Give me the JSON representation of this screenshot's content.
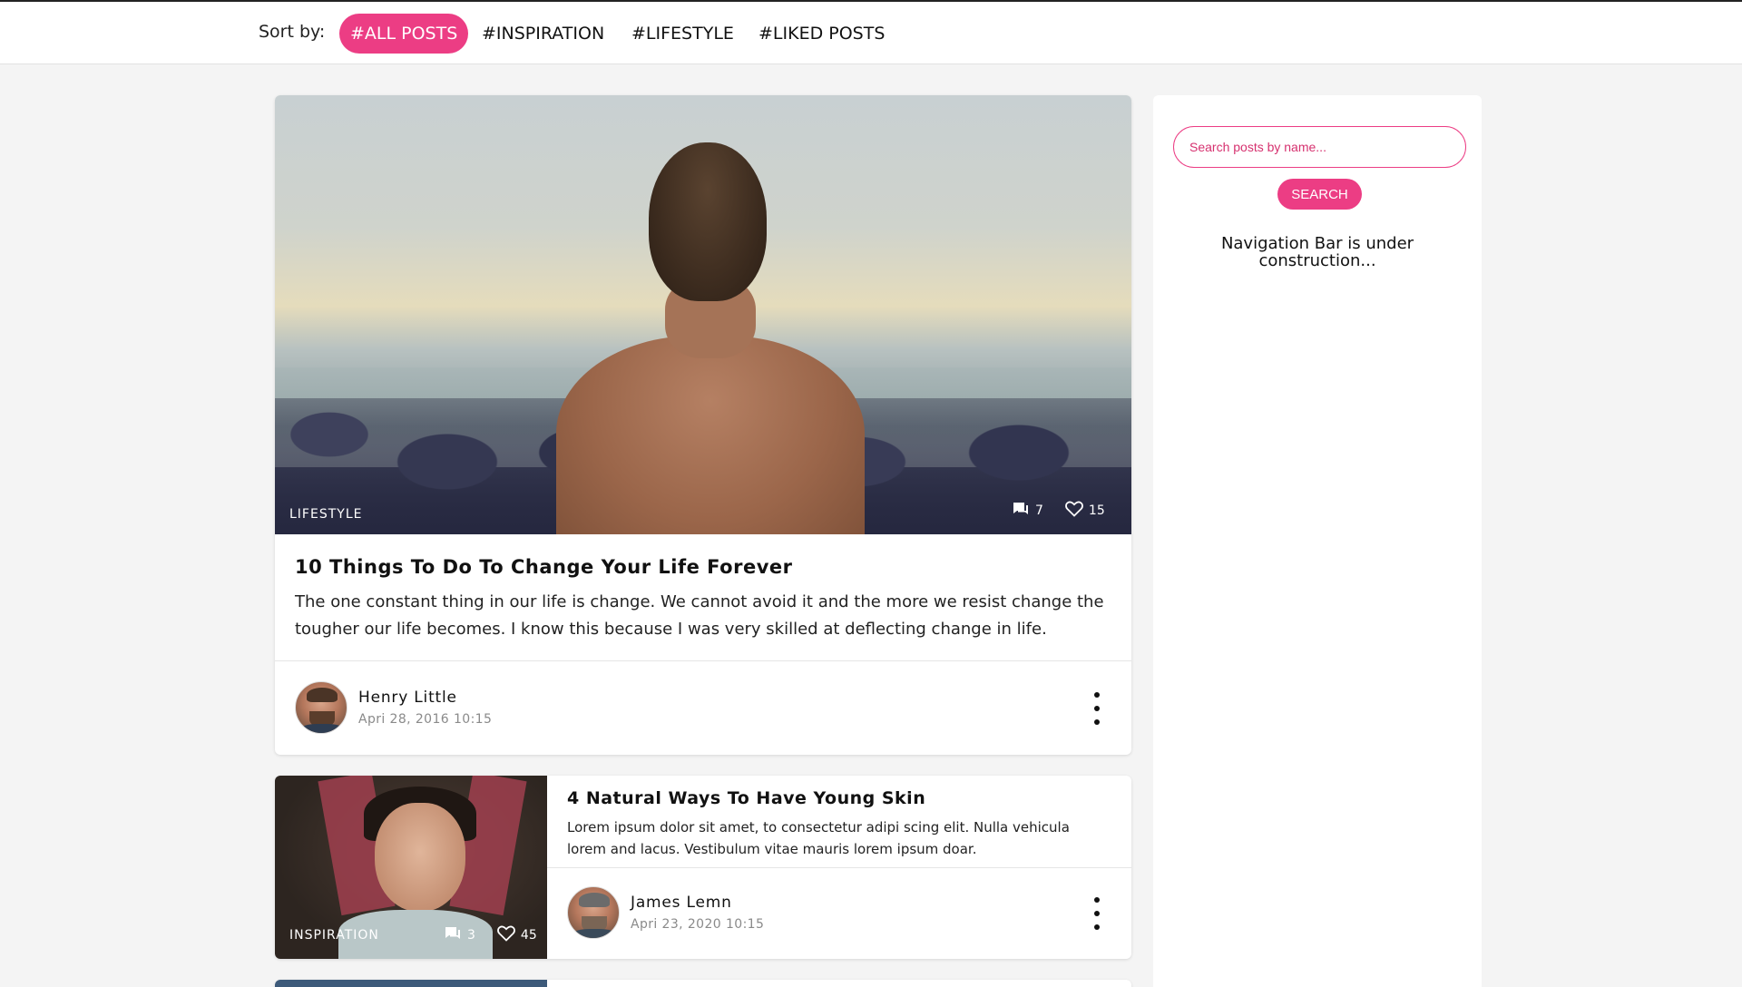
{
  "sort": {
    "label": "Sort by:",
    "tabs": [
      {
        "label": "#ALL POSTS",
        "active": true
      },
      {
        "label": "#INSPIRATION",
        "active": false
      },
      {
        "label": "#LIFESTYLE",
        "active": false
      },
      {
        "label": "#LIKED POSTS",
        "active": false
      }
    ]
  },
  "posts": [
    {
      "tag": "LIFESTYLE",
      "comments": "7",
      "likes": "15",
      "title": "10 Things To Do To Change Your Life Forever",
      "description": "The one constant thing in our life is change. We cannot avoid it and the more we resist change the tougher our life becomes. I know this because I was very skilled at deflecting change in life.",
      "author": "Henry Little",
      "date": "Apri 28, 2016 10:15"
    },
    {
      "tag": "INSPIRATION",
      "comments": "3",
      "likes": "45",
      "title": "4 Natural Ways To Have Young Skin",
      "description": "Lorem ipsum dolor sit amet, to consectetur adipi scing elit. Nulla vehicula lorem and lacus. Vestibulum vitae mauris lorem ipsum doar.",
      "author": "James Lemn",
      "date": "Apri 23, 2020 10:15"
    }
  ],
  "sidebar": {
    "search_placeholder": "Search posts by name...",
    "search_button": "SEARCH",
    "nav_note": "Navigation Bar is under construction..."
  },
  "colors": {
    "accent": "#ec3d84",
    "background": "#f4f4f4",
    "card": "#ffffff"
  },
  "icons": {
    "comments": "comment-icon",
    "likes": "heart-icon",
    "menu": "kebab-menu-icon"
  }
}
